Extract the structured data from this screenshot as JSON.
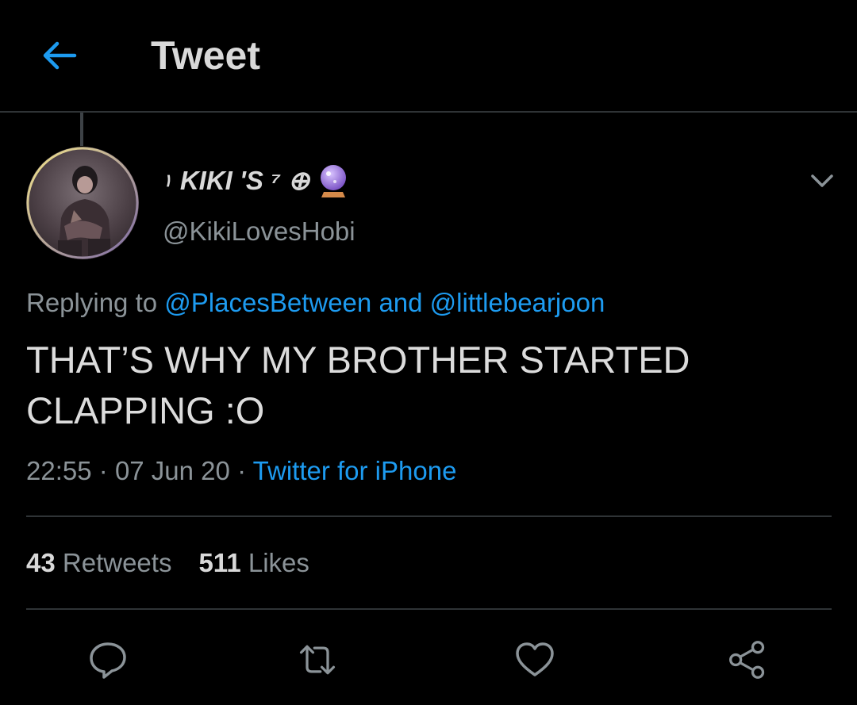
{
  "header": {
    "title": "Tweet",
    "back_icon": "arrow-left-icon",
    "accent": "#1d9bf0"
  },
  "tweet": {
    "author": {
      "name_prefix": "١",
      "name": "KIKI 'S ⁷ ⊕",
      "name_emoji": "crystal-ball-icon",
      "handle": "@KikiLovesHobi"
    },
    "replying": {
      "prefix": "Replying to",
      "mention_1": "@PlacesBetween",
      "connector": "and",
      "mention_2": "@littlebearjoon"
    },
    "text": "THAT’S WHY MY BROTHER STARTED CLAPPING :O",
    "meta": {
      "time": "22:55",
      "separator": "·",
      "date": "07 Jun 20",
      "source": "Twitter for iPhone"
    },
    "stats": {
      "retweets_count": "43",
      "retweets_label": "Retweets",
      "likes_count": "511",
      "likes_label": "Likes"
    }
  },
  "actions": {
    "reply_icon": "reply-icon",
    "retweet_icon": "retweet-icon",
    "like_icon": "heart-icon",
    "share_icon": "share-icon"
  },
  "colors": {
    "background": "#000000",
    "text_primary": "#d9d9d9",
    "text_secondary": "#8b9398",
    "link": "#1d9bf0",
    "divider": "#2f3336"
  }
}
